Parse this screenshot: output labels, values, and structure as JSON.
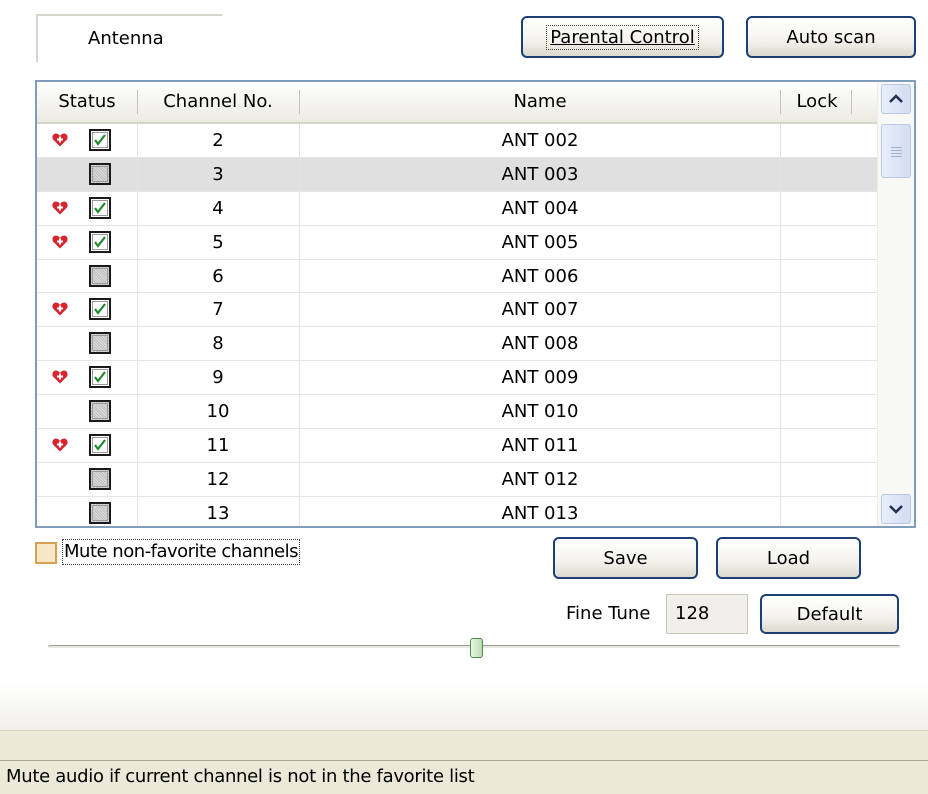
{
  "source_tab": {
    "label": "Antenna"
  },
  "toolbar": {
    "parental_control": "Parental Control",
    "auto_scan": "Auto scan"
  },
  "table": {
    "columns": {
      "status": "Status",
      "channel_no": "Channel No.",
      "name": "Name",
      "lock": "Lock"
    },
    "rows": [
      {
        "favorite": true,
        "enabled": true,
        "channel": "2",
        "name": "ANT 002",
        "selected": false
      },
      {
        "favorite": false,
        "enabled": false,
        "channel": "3",
        "name": "ANT 003",
        "selected": true
      },
      {
        "favorite": true,
        "enabled": true,
        "channel": "4",
        "name": "ANT 004",
        "selected": false
      },
      {
        "favorite": true,
        "enabled": true,
        "channel": "5",
        "name": "ANT 005",
        "selected": false
      },
      {
        "favorite": false,
        "enabled": false,
        "channel": "6",
        "name": "ANT 006",
        "selected": false
      },
      {
        "favorite": true,
        "enabled": true,
        "channel": "7",
        "name": "ANT 007",
        "selected": false
      },
      {
        "favorite": false,
        "enabled": false,
        "channel": "8",
        "name": "ANT 008",
        "selected": false
      },
      {
        "favorite": true,
        "enabled": true,
        "channel": "9",
        "name": "ANT 009",
        "selected": false
      },
      {
        "favorite": false,
        "enabled": false,
        "channel": "10",
        "name": "ANT 010",
        "selected": false
      },
      {
        "favorite": true,
        "enabled": true,
        "channel": "11",
        "name": "ANT 011",
        "selected": false
      },
      {
        "favorite": false,
        "enabled": false,
        "channel": "12",
        "name": "ANT 012",
        "selected": false
      },
      {
        "favorite": false,
        "enabled": false,
        "channel": "13",
        "name": "ANT 013",
        "selected": false
      }
    ]
  },
  "mute_option": {
    "label": "Mute non-favorite channels",
    "checked": false
  },
  "actions": {
    "save": "Save",
    "load": "Load"
  },
  "fine_tune": {
    "label": "Fine Tune",
    "value": "128",
    "default_button": "Default"
  },
  "status_bar": {
    "text": "Mute audio if current channel is not in the favorite list"
  },
  "colors": {
    "button_border": "#1e3f76",
    "favorite_heart": "#d8242c",
    "check_green": "#1f8a2a",
    "selected_row": "#e0e0e0"
  },
  "icons": {
    "favorite": "heart-plus-icon",
    "enabled": "checkbox-checked-icon",
    "disabled": "checkbox-disabled-icon"
  }
}
